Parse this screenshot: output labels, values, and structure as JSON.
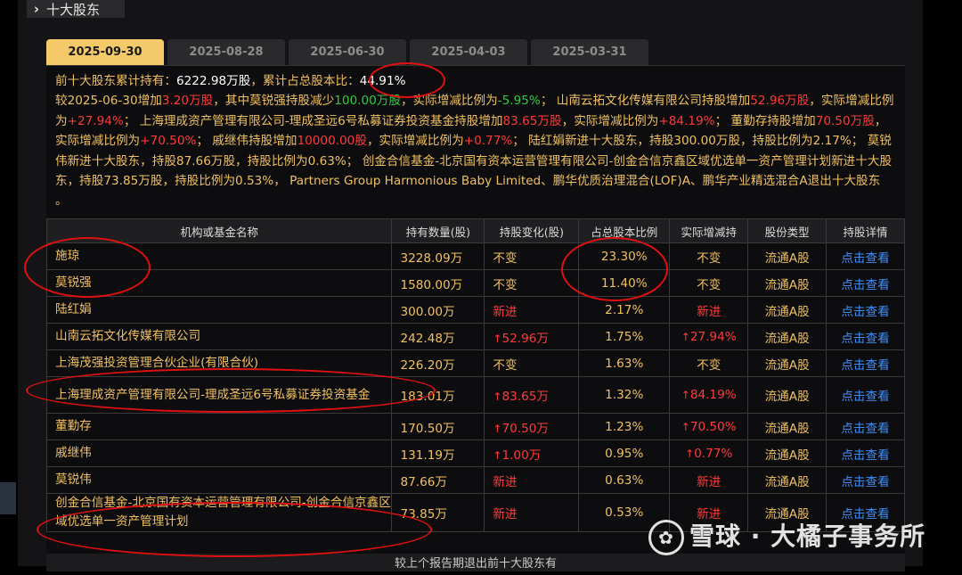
{
  "header": {
    "title": "十大股东"
  },
  "tabs": [
    {
      "label": "2025-09-30",
      "active": true
    },
    {
      "label": "2025-08-28",
      "active": false
    },
    {
      "label": "2025-06-30",
      "active": false
    },
    {
      "label": "2025-04-03",
      "active": false
    },
    {
      "label": "2025-03-31",
      "active": false
    }
  ],
  "summary": {
    "line1_label": "前十大股东累计持有：",
    "total_hold": "6222.98万股",
    "ratio_label": "，累计占总股本比：",
    "total_ratio": "44.91%",
    "p1": "较2025-06-30增加",
    "p1_val": "3.20万股",
    "p2": "，其中莫锐强持股减少",
    "p2_val": "100.00万股",
    "p3": "，实际增减比例为",
    "p3_val": "-5.95%",
    "p4": "； 山南云拓文化传媒有限公司持股增加",
    "p4_val": "52.96万股",
    "p5": "，实际增减比例为",
    "p5_val": "+27.94%",
    "p6": "； 上海理成资产管理有限公司-理成圣远6号私募证券投资基金持股增加",
    "p6_val": "83.65万股",
    "p7": "，实际增减比例为",
    "p7_val": "+84.19%",
    "p8": "； 董勤存持股增加",
    "p8_val": "70.50万股",
    "p9": "，实际增减比例为",
    "p9_val": "+70.50%",
    "p10": "； 戚继伟持股增加",
    "p10_val": "10000.00股",
    "p11": "，实际增减比例为",
    "p11_val": "+0.77%",
    "p12": "； 陆红娟新进十大股东，持股300.00万股，持股比例为2.17%； 莫锐伟新进十大股东，持股87.66万股，持股比例为0.63%； 创金合信基金-北京国有资本运营管理有限公司-创金合信京鑫区域优选单一资产管理计划新进十大股东，持股73.85万股，持股比例为0.53%， Partners Group Harmonious Baby Limited、鹏华优质治理混合(LOF)A、鹏华产业精选混合A退出十大股东 。"
  },
  "table": {
    "headers": [
      "机构或基金名称",
      "持有数量(股)",
      "持股变化(股)",
      "占总股本比例",
      "实际增减持",
      "股份类型",
      "持股详情"
    ],
    "rows": [
      {
        "name": "施琼",
        "hold": "3228.09万",
        "change": "不变",
        "change_type": "plain",
        "ratio": "23.30%",
        "actual": "不变",
        "actual_type": "plain",
        "type": "流通A股",
        "detail": "点击查看"
      },
      {
        "name": "莫锐强",
        "hold": "1580.00万",
        "change": "不变",
        "change_type": "plain",
        "ratio": "11.40%",
        "actual": "不变",
        "actual_type": "plain",
        "type": "流通A股",
        "detail": "点击查看"
      },
      {
        "name": "陆红娟",
        "hold": "300.00万",
        "change": "新进",
        "change_type": "new",
        "ratio": "2.17%",
        "actual": "新进",
        "actual_type": "new",
        "type": "流通A股",
        "detail": "点击查看"
      },
      {
        "name": "山南云拓文化传媒有限公司",
        "hold": "242.48万",
        "change": "52.96万",
        "change_type": "up",
        "ratio": "1.75%",
        "actual": "27.94%",
        "actual_type": "up",
        "type": "流通A股",
        "detail": "点击查看"
      },
      {
        "name": "上海茂强投资管理合伙企业(有限合伙)",
        "hold": "226.20万",
        "change": "不变",
        "change_type": "plain",
        "ratio": "1.63%",
        "actual": "不变",
        "actual_type": "plain",
        "type": "流通A股",
        "detail": "点击查看"
      },
      {
        "name": "上海理成资产管理有限公司-理成圣远6号私募证券投资基金",
        "hold": "183.01万",
        "change": "83.65万",
        "change_type": "up",
        "ratio": "1.32%",
        "actual": "84.19%",
        "actual_type": "up",
        "type": "流通A股",
        "detail": "点击查看"
      },
      {
        "name": "董勤存",
        "hold": "170.50万",
        "change": "70.50万",
        "change_type": "up",
        "ratio": "1.23%",
        "actual": "70.50%",
        "actual_type": "up",
        "type": "流通A股",
        "detail": "点击查看"
      },
      {
        "name": "戚继伟",
        "hold": "131.19万",
        "change": "1.00万",
        "change_type": "up",
        "ratio": "0.95%",
        "actual": "0.77%",
        "actual_type": "up",
        "type": "流通A股",
        "detail": "点击查看"
      },
      {
        "name": "莫锐伟",
        "hold": "87.66万",
        "change": "新进",
        "change_type": "new",
        "ratio": "0.63%",
        "actual": "新进",
        "actual_type": "new",
        "type": "流通A股",
        "detail": "点击查看"
      },
      {
        "name": "创金合信基金-北京国有资本运营管理有限公司-创金合信京鑫区域优选单一资产管理计划",
        "hold": "73.85万",
        "change": "新进",
        "change_type": "new",
        "ratio": "0.53%",
        "actual": "新进",
        "actual_type": "new",
        "type": "流通A股",
        "detail": "点击查看"
      }
    ]
  },
  "footer": {
    "text": "较上个报告期退出前十大股东有"
  },
  "watermark": {
    "text": "雪球 · 大橘子事务所"
  },
  "colors": {
    "accent": "#f3c96a",
    "red": "#ff3a3a",
    "green": "#2ecc40",
    "link": "#3e8ef7",
    "text": "#f0c060",
    "annotation": "#e01010"
  }
}
